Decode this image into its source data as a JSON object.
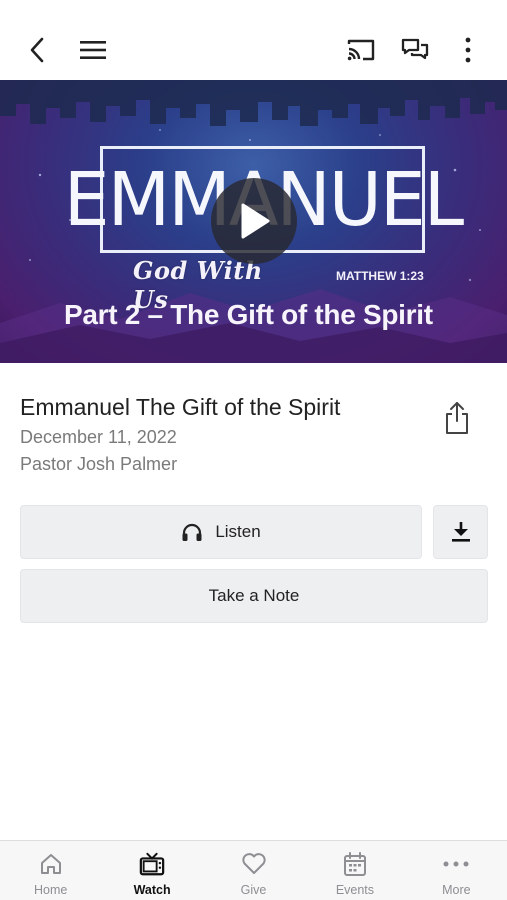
{
  "header": {
    "back_icon": "chevron-left-icon",
    "menu_icon": "hamburger-menu-icon",
    "cast_icon": "cast-icon",
    "chat_icon": "chat-bubbles-icon",
    "more_icon": "vertical-dots-icon"
  },
  "hero": {
    "title_word": "EMMANUEL",
    "subtitle": "God With Us",
    "scripture": "MATTHEW 1:23",
    "part_line": "Part 2 – The Gift of the Spirit",
    "play_icon": "play-icon"
  },
  "sermon": {
    "title": "Emmanuel The Gift of the Spirit",
    "date": "December 11, 2022",
    "speaker": "Pastor Josh Palmer",
    "share_icon": "share-icon"
  },
  "actions": {
    "listen_label": "Listen",
    "listen_icon": "headphones-icon",
    "download_icon": "download-icon",
    "note_label": "Take a Note"
  },
  "tabs": [
    {
      "label": "Home",
      "icon": "home-icon",
      "active": false
    },
    {
      "label": "Watch",
      "icon": "tv-icon",
      "active": true
    },
    {
      "label": "Give",
      "icon": "heart-icon",
      "active": false
    },
    {
      "label": "Events",
      "icon": "calendar-icon",
      "active": false
    },
    {
      "label": "More",
      "icon": "horizontal-dots-icon",
      "active": false
    }
  ],
  "colors": {
    "accent_active": "#111111",
    "inactive_tab": "#8e8e93",
    "button_bg": "#eeeff1",
    "hero_purple": "#4a1f6e",
    "hero_blue": "#3d5fa8"
  }
}
